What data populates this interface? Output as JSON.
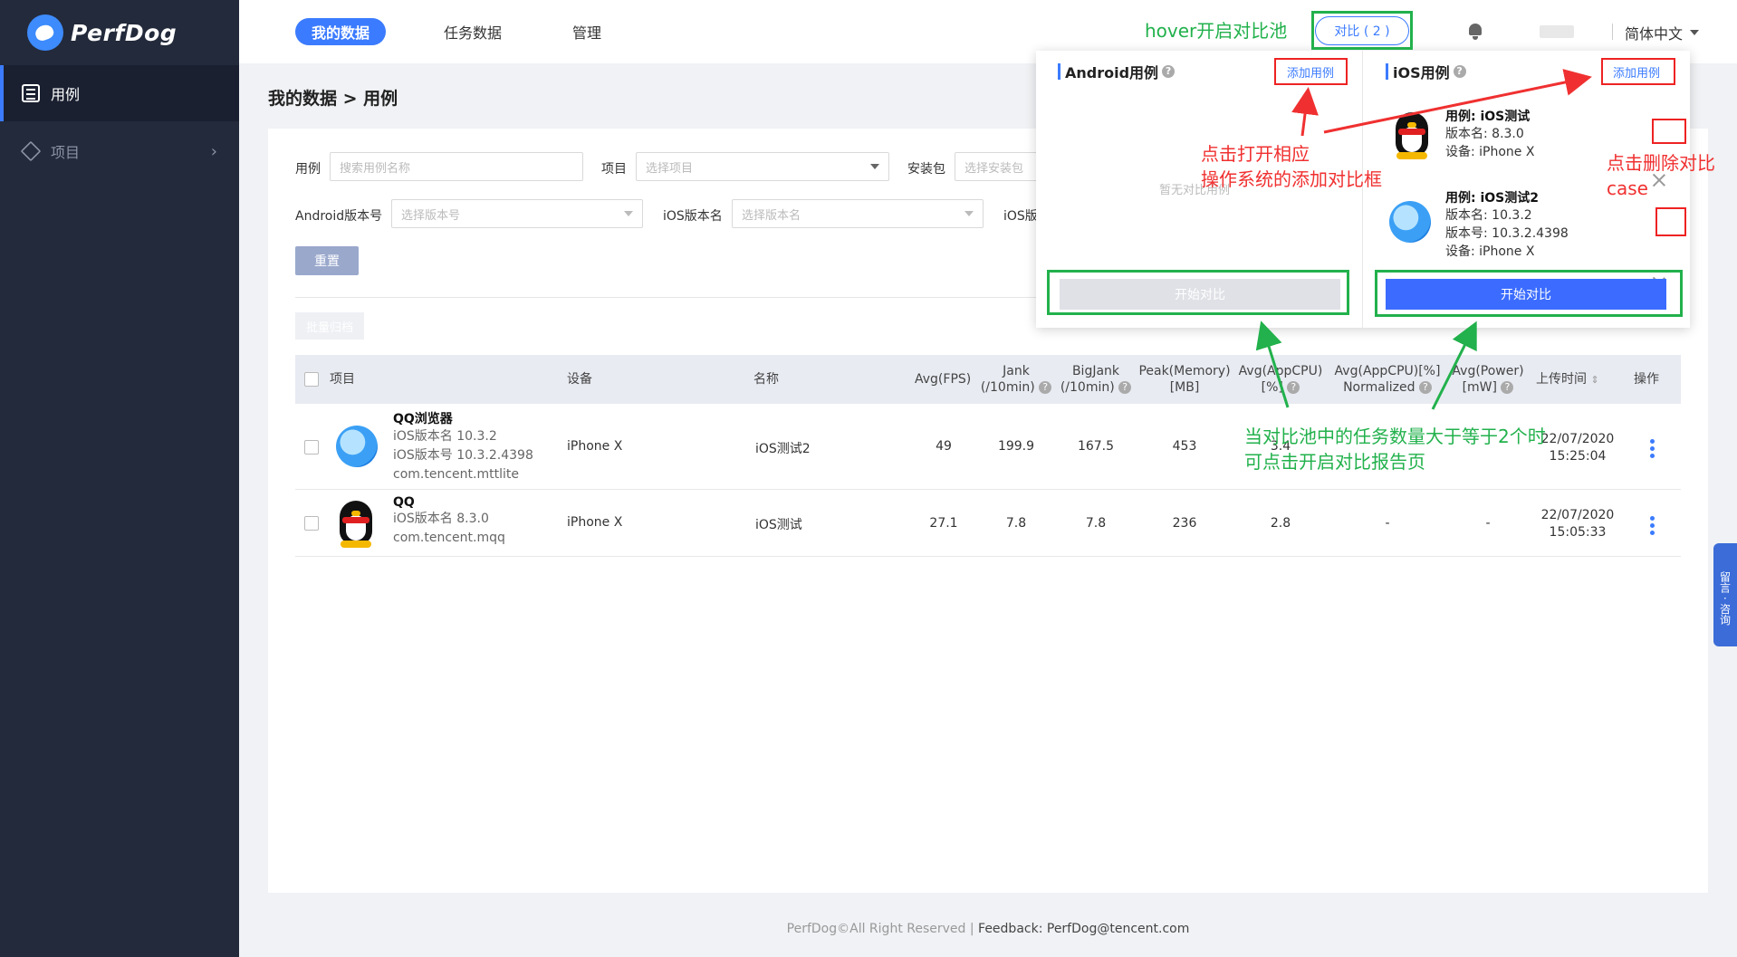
{
  "app": {
    "name": "PerfDog"
  },
  "sidebar": {
    "items": [
      {
        "label": "用例",
        "active": true
      },
      {
        "label": "项目",
        "active": false
      }
    ]
  },
  "topnav": {
    "tabs": [
      "我的数据",
      "任务数据",
      "管理"
    ],
    "compare_button": "对比 ( 2 )",
    "language": "简体中文"
  },
  "breadcrumb": "我的数据 > 用例",
  "filters": {
    "case_label": "用例",
    "case_placeholder": "搜索用例名称",
    "project_label": "项目",
    "project_placeholder": "选择项目",
    "package_label": "安装包",
    "package_placeholder": "选择安装包",
    "android_version_label": "Android版本号",
    "android_version_placeholder": "选择版本号",
    "ios_name_label": "iOS版本名",
    "ios_name_placeholder": "选择版本名",
    "ios_extra_label": "iOS版",
    "reset_button": "重置",
    "archive_button": "批量归档"
  },
  "table": {
    "headers": {
      "project": "项目",
      "device": "设备",
      "name": "名称",
      "avg_fps": "Avg(FPS)",
      "jank_1": "Jank",
      "jank_2": "(/10min)",
      "bigjank_1": "BigJank",
      "bigjank_2": "(/10min)",
      "peak_memory_1": "Peak(Memory)",
      "peak_memory_2": "[MB]",
      "avg_cpu_1": "Avg(AppCPU)",
      "avg_cpu_2": "[%]",
      "avg_cpu_norm_1": "Avg(AppCPU)[%]",
      "avg_cpu_norm_2": "Normalized",
      "avg_power_1": "Avg(Power)",
      "avg_power_2": "[mW]",
      "upload_time": "上传时间",
      "actions": "操作"
    },
    "rows": [
      {
        "app_name": "QQ浏览器",
        "line1": "iOS版本名 10.3.2",
        "line2": "iOS版本号 10.3.2.4398",
        "line3": "com.tencent.mttlite",
        "device": "iPhone X",
        "name": "iOS测试2",
        "avg_fps": "49",
        "jank": "199.9",
        "bigjank": "167.5",
        "peak_memory": "453",
        "avg_cpu": "3.4",
        "avg_cpu_norm": "",
        "avg_power": "",
        "upload_date": "22/07/2020",
        "upload_time": "15:25:04"
      },
      {
        "app_name": "QQ",
        "line1": "iOS版本名 8.3.0",
        "line2": "com.tencent.mqq",
        "device": "iPhone X",
        "name": "iOS测试",
        "avg_fps": "27.1",
        "jank": "7.8",
        "bigjank": "7.8",
        "peak_memory": "236",
        "avg_cpu": "2.8",
        "avg_cpu_norm": "-",
        "avg_power": "-",
        "upload_date": "22/07/2020",
        "upload_time": "15:05:33"
      }
    ]
  },
  "compare_popover": {
    "android": {
      "title": "Android用例",
      "add": "添加用例",
      "empty": "暂无对比用例",
      "start": "开始对比"
    },
    "ios": {
      "title": "iOS用例",
      "add": "添加用例",
      "start": "开始对比",
      "cases": [
        {
          "title": "用例: iOS测试",
          "line1": "版本名: 8.3.0",
          "line2": "设备: iPhone X",
          "line3": ""
        },
        {
          "title": "用例: iOS测试2",
          "line1": "版本名: 10.3.2",
          "line2": "版本号: 10.3.2.4398",
          "line3": "设备: iPhone X"
        }
      ]
    }
  },
  "annotations": {
    "hover": "hover开启对比池",
    "open_add_1": "点击打开相应",
    "open_add_2": "操作系统的添加对比框",
    "delete_1": "点击删除对比",
    "delete_2": "case",
    "pool_1": "当对比池中的任务数量大于等于2个时",
    "pool_2": "可点击开启对比报告页"
  },
  "footer": {
    "copyright": "PerfDog©All Right Reserved | ",
    "feedback": "Feedback: PerfDog@tencent.com"
  },
  "side_tab": "留言 · 咨询",
  "colors": {
    "accent": "#3b7bff",
    "sidebar_bg": "#232a3b",
    "annotation_red": "#f03030",
    "annotation_green": "#22b14c"
  }
}
